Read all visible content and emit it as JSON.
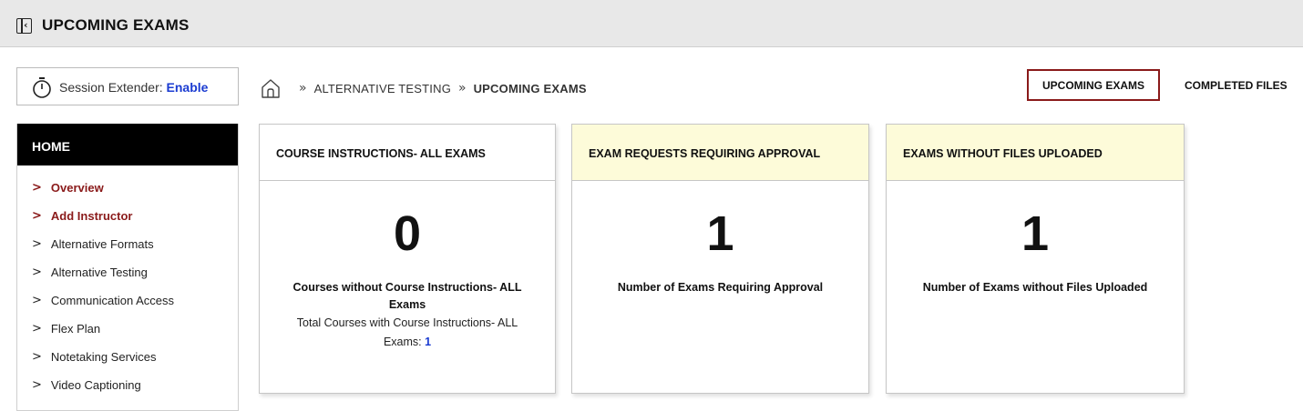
{
  "header": {
    "title": "UPCOMING EXAMS",
    "collapse_icon": "collapse-sidebar-icon"
  },
  "session": {
    "label": "Session Extender:",
    "link": "Enable",
    "icon": "stopwatch-icon"
  },
  "breadcrumb": {
    "home_icon": "home-icon",
    "separator": "»",
    "items": [
      "ALTERNATIVE TESTING",
      "UPCOMING EXAMS"
    ]
  },
  "tabs": {
    "upcoming": "UPCOMING EXAMS",
    "completed": "COMPLETED FILES"
  },
  "sidebar": {
    "heading": "HOME",
    "chevron": ">",
    "items": [
      {
        "label": "Overview"
      },
      {
        "label": "Add Instructor"
      },
      {
        "label": "Alternative Formats"
      },
      {
        "label": "Alternative Testing"
      },
      {
        "label": "Communication Access"
      },
      {
        "label": "Flex Plan"
      },
      {
        "label": "Notetaking Services"
      },
      {
        "label": "Video Captioning"
      }
    ]
  },
  "cards": [
    {
      "title": "COURSE INSTRUCTIONS- ALL EXAMS",
      "count": "0",
      "desc": "Courses without Course Instructions- ALL Exams",
      "sub_text": "Total Courses with Course Instructions- ALL Exams:",
      "sub_value": "1"
    },
    {
      "title": "EXAM REQUESTS REQUIRING APPROVAL",
      "count": "1",
      "desc": "Number of Exams Requiring Approval"
    },
    {
      "title": "EXAMS WITHOUT FILES UPLOADED",
      "count": "1",
      "desc": "Number of Exams without Files Uploaded"
    }
  ],
  "colors": {
    "accent": "#8a1a1a",
    "link": "#1a3bd1",
    "highlight_header": "#fdfbd9"
  }
}
